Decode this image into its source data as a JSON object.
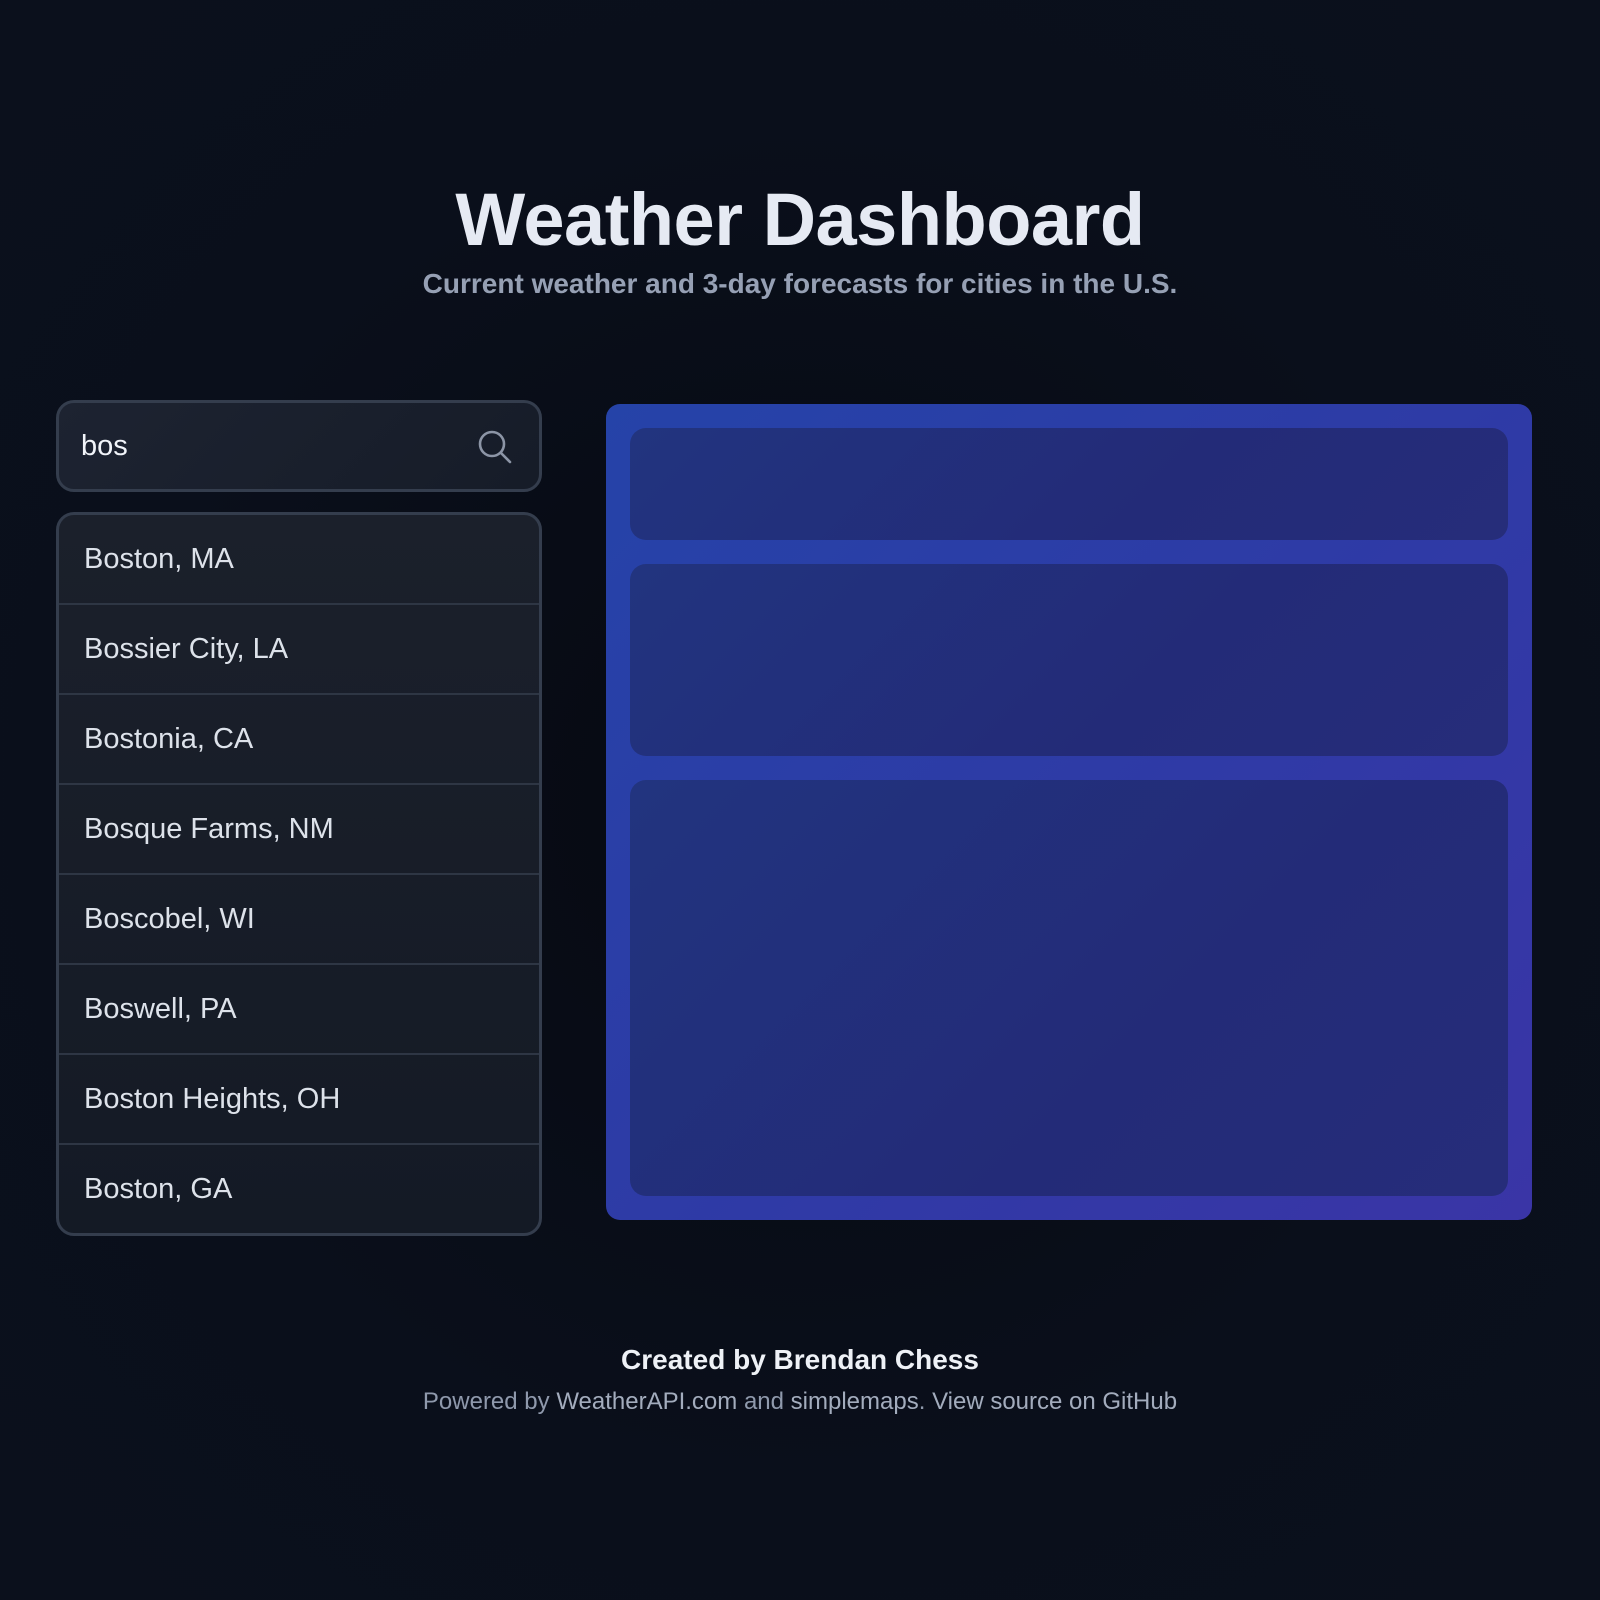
{
  "header": {
    "title": "Weather Dashboard",
    "subtitle": "Current weather and 3-day forecasts for cities in the U.S."
  },
  "search": {
    "value": "bos",
    "icon": "search-icon"
  },
  "results": [
    "Boston, MA",
    "Bossier City, LA",
    "Bostonia, CA",
    "Bosque Farms, NM",
    "Boscobel, WI",
    "Boswell, PA",
    "Boston Heights, OH",
    "Boston, GA"
  ],
  "footer": {
    "credit": "Created by Brendan Chess",
    "powered_prefix": "Powered by ",
    "weatherapi_link": "WeatherAPI.com",
    "and_text": " and ",
    "simplemaps_link": "simplemaps",
    "period": ". ",
    "github_link": "View source on GitHub"
  },
  "colors": {
    "background": "#0a0f1b",
    "panel_accent": "#2f3aa6",
    "skeleton": "#232b78",
    "text_primary": "#e6eaf3",
    "text_muted": "#96a0b4"
  }
}
